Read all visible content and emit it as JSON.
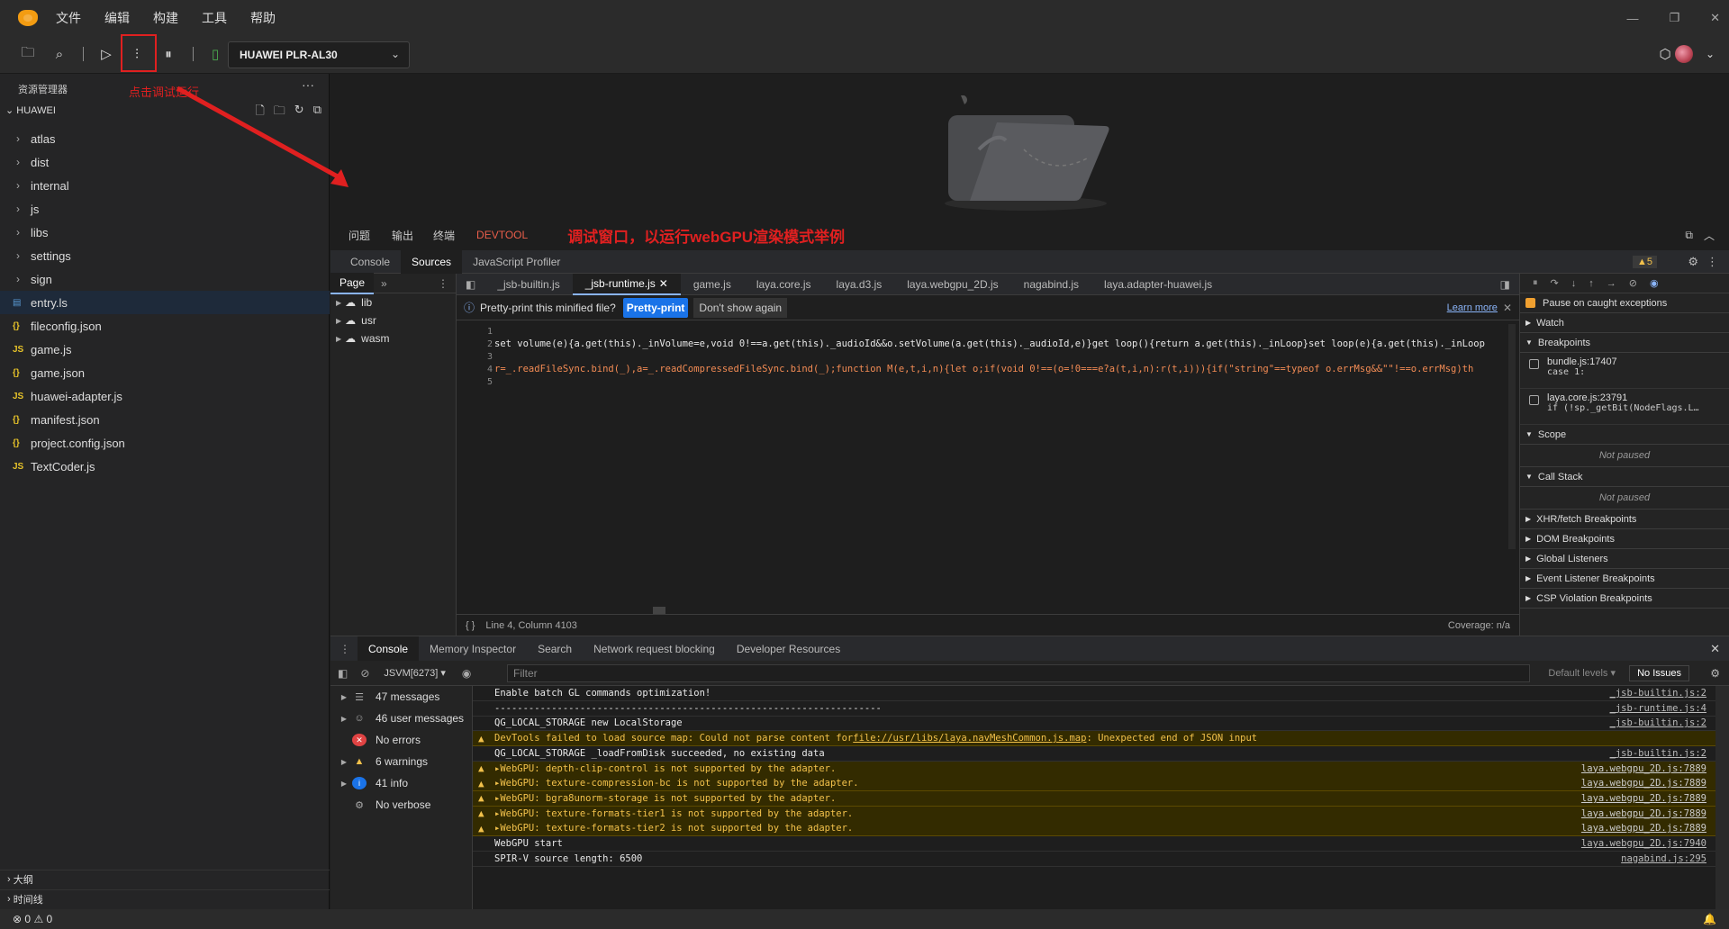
{
  "menu": [
    "文件",
    "编辑",
    "构建",
    "工具",
    "帮助"
  ],
  "toolbar": {
    "device": "HUAWEI PLR-AL30"
  },
  "annotations": {
    "click_debug": "点击调试运行",
    "debug_window": "调试窗口，以运行webGPU渲染模式举例"
  },
  "sidebar": {
    "title": "资源管理器",
    "project": "HUAWEI",
    "items": [
      {
        "label": "atlas",
        "type": "folder"
      },
      {
        "label": "dist",
        "type": "folder"
      },
      {
        "label": "internal",
        "type": "folder"
      },
      {
        "label": "js",
        "type": "folder"
      },
      {
        "label": "libs",
        "type": "folder"
      },
      {
        "label": "settings",
        "type": "folder"
      },
      {
        "label": "sign",
        "type": "folder"
      },
      {
        "label": "entry.ls",
        "type": "ls"
      },
      {
        "label": "fileconfig.json",
        "type": "json"
      },
      {
        "label": "game.js",
        "type": "js"
      },
      {
        "label": "game.json",
        "type": "json"
      },
      {
        "label": "huawei-adapter.js",
        "type": "js"
      },
      {
        "label": "manifest.json",
        "type": "json"
      },
      {
        "label": "project.config.json",
        "type": "json"
      },
      {
        "label": "TextCoder.js",
        "type": "js"
      }
    ],
    "bottom": [
      "大纲",
      "时间线"
    ]
  },
  "panel_tabs": [
    "问题",
    "输出",
    "终端",
    "DEVTOOL"
  ],
  "devtools": {
    "tabs": [
      "Console",
      "Sources",
      "JavaScript Profiler"
    ],
    "warn_count": "5",
    "nav_tab": "Page",
    "nav_items": [
      "lib",
      "usr",
      "wasm"
    ],
    "file_tabs": [
      "_jsb-builtin.js",
      "_jsb-runtime.js",
      "game.js",
      "laya.core.js",
      "laya.d3.js",
      "laya.webgpu_2D.js",
      "nagabind.js",
      "laya.adapter-huawei.js"
    ],
    "infobar": {
      "text": "Pretty-print this minified file?",
      "btn": "Pretty-print",
      "dismiss": "Don't show again",
      "learn": "Learn more"
    },
    "line_numbers": [
      "1",
      "2",
      "3",
      "4",
      "5"
    ],
    "code_line2": "set volume(e){a.get(this)._inVolume=e,void 0!==a.get(this)._audioId&&o.setVolume(a.get(this)._audioId,e)}get loop(){return a.get(this)._inLoop}set loop(e){a.get(this)._inLoop",
    "code_line4": "r=_.readFileSync.bind(_),a=_.readCompressedFileSync.bind(_);function M(e,t,i,n){let o;if(void 0!==(o=!0===e?a(t,i,n):r(t,i))){if(\"string\"==typeof o.errMsg&&\"\"!==o.errMsg)th",
    "cursor": "Line 4, Column 4103",
    "coverage": "Coverage: n/a"
  },
  "debugger": {
    "pause_caught": "Pause on caught exceptions",
    "watch": "Watch",
    "breakpoints": "Breakpoints",
    "bp1": {
      "loc": "bundle.js:17407",
      "code": "case 1:"
    },
    "bp2": {
      "loc": "laya.core.js:23791",
      "code": "if (!sp._getBit(NodeFlags.L…"
    },
    "scope": "Scope",
    "not_paused": "Not paused",
    "call_stack": "Call Stack",
    "sections": [
      "XHR/fetch Breakpoints",
      "DOM Breakpoints",
      "Global Listeners",
      "Event Listener Breakpoints",
      "CSP Violation Breakpoints"
    ]
  },
  "drawer_tabs": [
    "Console",
    "Memory Inspector",
    "Search",
    "Network request blocking",
    "Developer Resources"
  ],
  "console_toolbar": {
    "context": "JSVM[6273]",
    "filter": "Filter",
    "levels": "Default levels",
    "issues": "No Issues"
  },
  "console_side": [
    {
      "label": "47 messages",
      "icon": "list"
    },
    {
      "label": "46 user messages",
      "icon": "user"
    },
    {
      "label": "No errors",
      "icon": "error"
    },
    {
      "label": "6 warnings",
      "icon": "warn"
    },
    {
      "label": "41 info",
      "icon": "info"
    },
    {
      "label": "No verbose",
      "icon": "verbose"
    }
  ],
  "console_msgs": [
    {
      "text": "Enable batch GL commands optimization!",
      "src": "_jsb-builtin.js:2",
      "warn": false
    },
    {
      "text": "--------------------------------------------------------------------",
      "src": "_jsb-runtime.js:4",
      "warn": false
    },
    {
      "text": "QG_LOCAL_STORAGE new LocalStorage",
      "src": "_jsb-builtin.js:2",
      "warn": false
    },
    {
      "text": "DevTools failed to load source map: Could not parse content for ",
      "link": "file://usr/libs/laya.navMeshCommon.js.map",
      "tail": ": Unexpected end of JSON input",
      "src": "",
      "warn": true
    },
    {
      "text": "QG_LOCAL_STORAGE _loadFromDisk succeeded, no existing data",
      "src": "_jsb-builtin.js:2",
      "warn": false
    },
    {
      "text": "▸WebGPU: depth-clip-control is not supported by the adapter.",
      "src": "laya.webgpu_2D.js:7889",
      "warn": true
    },
    {
      "text": "▸WebGPU: texture-compression-bc is not supported by the adapter.",
      "src": "laya.webgpu_2D.js:7889",
      "warn": true
    },
    {
      "text": "▸WebGPU: bgra8unorm-storage is not supported by the adapter.",
      "src": "laya.webgpu_2D.js:7889",
      "warn": true
    },
    {
      "text": "▸WebGPU: texture-formats-tier1 is not supported by the adapter.",
      "src": "laya.webgpu_2D.js:7889",
      "warn": true
    },
    {
      "text": "▸WebGPU: texture-formats-tier2 is not supported by the adapter.",
      "src": "laya.webgpu_2D.js:7889",
      "warn": true
    },
    {
      "text": "WebGPU start",
      "src": "laya.webgpu_2D.js:7940",
      "warn": false
    },
    {
      "text": "SPIR-V source length:  6500",
      "src": "nagabind.js:295",
      "warn": false
    }
  ],
  "status": {
    "errors": "0",
    "warnings": "0"
  }
}
